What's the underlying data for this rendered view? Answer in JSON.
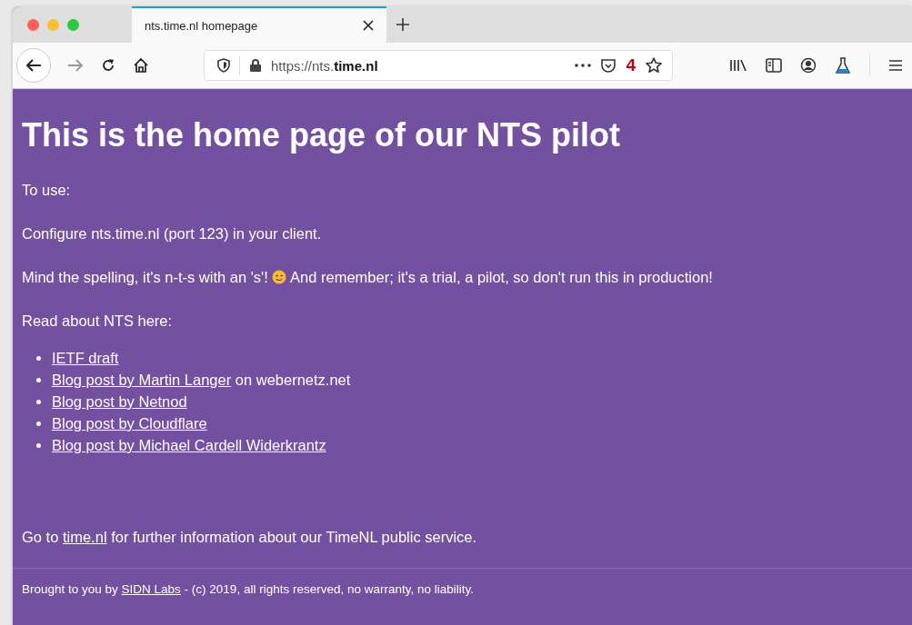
{
  "browser": {
    "tabs": [
      {
        "title": "nts.time.nl homepage",
        "selected": true
      }
    ],
    "url": "https://nts.**time.nl**",
    "badge": "4"
  },
  "page": {
    "heading": "This is the home page of our NTS pilot",
    "paragraphs": [
      {
        "segments": [
          {
            "kind": "text",
            "text": "To use:"
          }
        ]
      },
      {
        "segments": [
          {
            "kind": "text",
            "text": "Configure nts.time.nl (port 123) in your client."
          }
        ]
      },
      {
        "segments": [
          {
            "kind": "text",
            "text": "Mind the spelling, it's n-t-s with an 's'! "
          },
          {
            "kind": "emoji"
          },
          {
            "kind": "text",
            "text": " And remember; it's a trial, a pilot, so don't run this in production!"
          }
        ]
      },
      {
        "segments": [
          {
            "kind": "text",
            "text": "Read about NTS here:"
          }
        ]
      }
    ],
    "links": [
      {
        "link": "IETF draft"
      },
      {
        "link": "Blog post by Martin Langer",
        "after": " on webernetz.net"
      },
      {
        "link": "Blog post by Netnod"
      },
      {
        "link": "Blog post by Cloudflare"
      },
      {
        "link": "Blog post by Michael Cardell Widerkrantz"
      }
    ],
    "goto": {
      "before": "Go to ",
      "link": "time.nl",
      "after": " for further information about our TimeNL public service."
    },
    "footer": {
      "before": "Brought to you by ",
      "link": "SIDN Labs",
      "after": " - (c) 2019, all rights reserved, no warranty, no liability."
    }
  }
}
